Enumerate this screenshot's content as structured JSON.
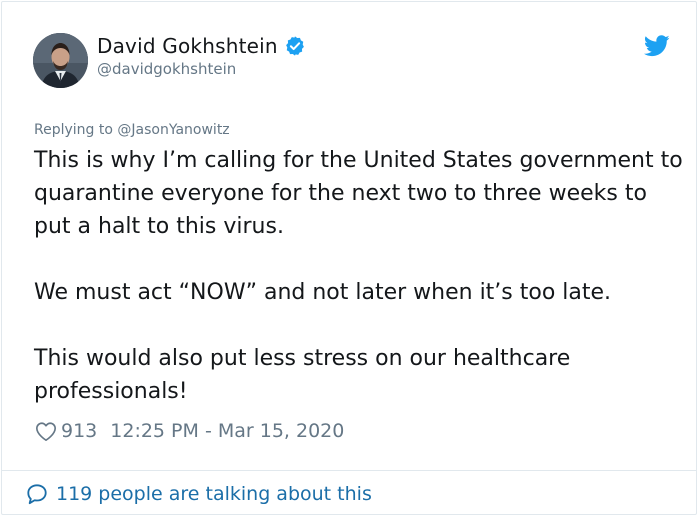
{
  "author": {
    "display_name": "David Gokhshtein",
    "handle": "@davidgokhshtein",
    "verified": true
  },
  "reply": {
    "prefix": "Replying to ",
    "to": "@JasonYanowitz"
  },
  "tweet": {
    "paragraphs": [
      "This is why I’m calling for the United States government to quarantine everyone for the next two to three weeks to put a halt to this virus.",
      "We must act “NOW” and not later when it’s too late.",
      "This would also put less stress on our healthcare professionals!"
    ]
  },
  "meta": {
    "likes": "913",
    "timestamp": "12:25 PM - Mar 15, 2020"
  },
  "footer": {
    "talking_text": "119 people are talking about this"
  },
  "icons": {
    "verified": "verified-badge-icon",
    "brand": "twitter-bird-icon",
    "like": "heart-icon",
    "conversation": "speech-bubble-icon"
  },
  "colors": {
    "twitter_blue": "#1da1f2",
    "link_blue": "#1b6ea8",
    "text": "#14171a",
    "muted": "#657786",
    "border": "#e1e8ed"
  }
}
